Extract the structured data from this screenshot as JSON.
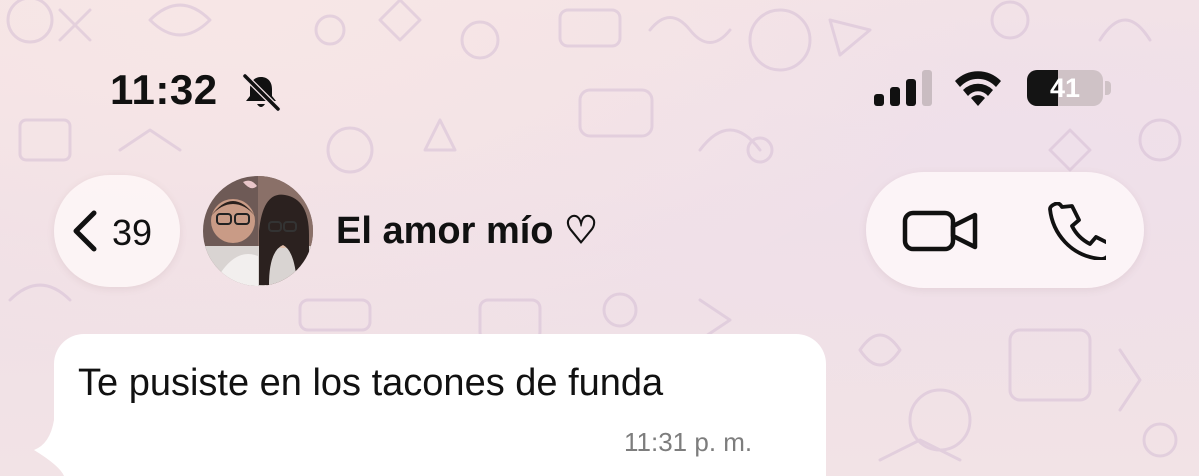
{
  "status_bar": {
    "time": "11:32",
    "battery_level": "41",
    "battery_fraction": 0.41,
    "signal_bars_active": 3,
    "signal_bars_total": 4,
    "icons": [
      "bell-muted-icon",
      "signal-icon",
      "wifi-icon",
      "battery-icon"
    ]
  },
  "header": {
    "back_count": "39",
    "contact_name": "El amor mío ♡",
    "icons": [
      "chevron-left-icon",
      "avatar",
      "video-camera-icon",
      "phone-icon"
    ]
  },
  "messages": [
    {
      "text": "Te pusiste en los tacones de funda",
      "time": "11:31 p. m.",
      "direction": "incoming"
    }
  ],
  "colors": {
    "bubble": "#ffffff",
    "text": "#111111",
    "timestamp": "#7d7d7d",
    "wallpaper": "#f3e2e6",
    "doodle": "#d9c3d8"
  }
}
